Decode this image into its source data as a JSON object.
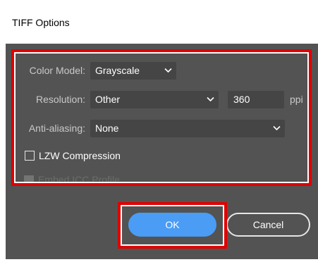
{
  "window": {
    "title": "TIFF Options"
  },
  "options": {
    "color_model": {
      "label": "Color Model:",
      "value": "Grayscale"
    },
    "resolution": {
      "label": "Resolution:",
      "value": "Other",
      "custom_value": "360",
      "unit": "ppi"
    },
    "anti_aliasing": {
      "label": "Anti-aliasing:",
      "value": "None"
    },
    "lzw_compression": {
      "label": "LZW Compression",
      "checked": false
    },
    "embed_icc_profile": {
      "label": "Embed ICC Profile",
      "checked": true,
      "enabled": false
    }
  },
  "buttons": {
    "ok": "OK",
    "cancel": "Cancel"
  },
  "colors": {
    "dialog_bg": "#535353",
    "field_bg": "#454545",
    "label_text": "#c9c9c9",
    "primary_button": "#4a9cf5",
    "highlight_frame": "#e00000"
  },
  "icons": {
    "dropdown": "chevron-down-icon",
    "checkbox_unchecked": "checkbox-empty"
  }
}
